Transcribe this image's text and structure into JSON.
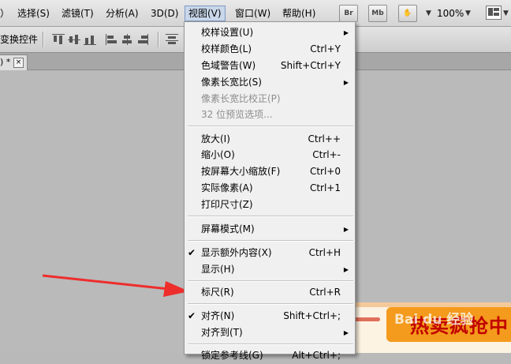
{
  "menubar": {
    "items": [
      "）",
      "选择(S)",
      "滤镜(T)",
      "分析(A)",
      "3D(D)",
      "视图(V)",
      "窗口(W)",
      "帮助(H)"
    ],
    "br_label": "Br",
    "mb_label": "Mb",
    "zoom": "100%"
  },
  "options": {
    "transform_label": "变换控件"
  },
  "tab": {
    "title": ") *",
    "close": "×"
  },
  "document": {
    "banner": "热卖疯抢中",
    "watermark": "Bai du 经验"
  },
  "view_menu": {
    "items": [
      {
        "label": "校样设置(U)",
        "shortcut": "",
        "submenu": true,
        "checked": false,
        "disabled": false
      },
      {
        "label": "校样颜色(L)",
        "shortcut": "Ctrl+Y",
        "submenu": false,
        "checked": false,
        "disabled": false
      },
      {
        "label": "色域警告(W)",
        "shortcut": "Shift+Ctrl+Y",
        "submenu": false,
        "checked": false,
        "disabled": false
      },
      {
        "label": "像素长宽比(S)",
        "shortcut": "",
        "submenu": true,
        "checked": false,
        "disabled": false
      },
      {
        "label": "像素长宽比校正(P)",
        "shortcut": "",
        "submenu": false,
        "checked": false,
        "disabled": true
      },
      {
        "label": "32 位预览选项...",
        "shortcut": "",
        "submenu": false,
        "checked": false,
        "disabled": true
      },
      {
        "label": "放大(I)",
        "shortcut": "Ctrl++",
        "submenu": false,
        "checked": false,
        "disabled": false
      },
      {
        "label": "缩小(O)",
        "shortcut": "Ctrl+-",
        "submenu": false,
        "checked": false,
        "disabled": false
      },
      {
        "label": "按屏幕大小缩放(F)",
        "shortcut": "Ctrl+0",
        "submenu": false,
        "checked": false,
        "disabled": false
      },
      {
        "label": "实际像素(A)",
        "shortcut": "Ctrl+1",
        "submenu": false,
        "checked": false,
        "disabled": false
      },
      {
        "label": "打印尺寸(Z)",
        "shortcut": "",
        "submenu": false,
        "checked": false,
        "disabled": false
      },
      {
        "label": "屏幕模式(M)",
        "shortcut": "",
        "submenu": true,
        "checked": false,
        "disabled": false
      },
      {
        "label": "显示额外内容(X)",
        "shortcut": "Ctrl+H",
        "submenu": false,
        "checked": true,
        "disabled": false
      },
      {
        "label": "显示(H)",
        "shortcut": "",
        "submenu": true,
        "checked": false,
        "disabled": false
      },
      {
        "label": "标尺(R)",
        "shortcut": "Ctrl+R",
        "submenu": false,
        "checked": false,
        "disabled": false
      },
      {
        "label": "对齐(N)",
        "shortcut": "Shift+Ctrl+;",
        "submenu": false,
        "checked": true,
        "disabled": false
      },
      {
        "label": "对齐到(T)",
        "shortcut": "",
        "submenu": true,
        "checked": false,
        "disabled": false
      },
      {
        "label": "锁定参考线(G)",
        "shortcut": "Alt+Ctrl+;",
        "submenu": false,
        "checked": false,
        "disabled": false
      }
    ],
    "check_glyph": "✔",
    "submenu_glyph": "▶"
  },
  "colors": {
    "arrow": "#ee2d2d",
    "menu_highlight": "#c9d7ea"
  }
}
